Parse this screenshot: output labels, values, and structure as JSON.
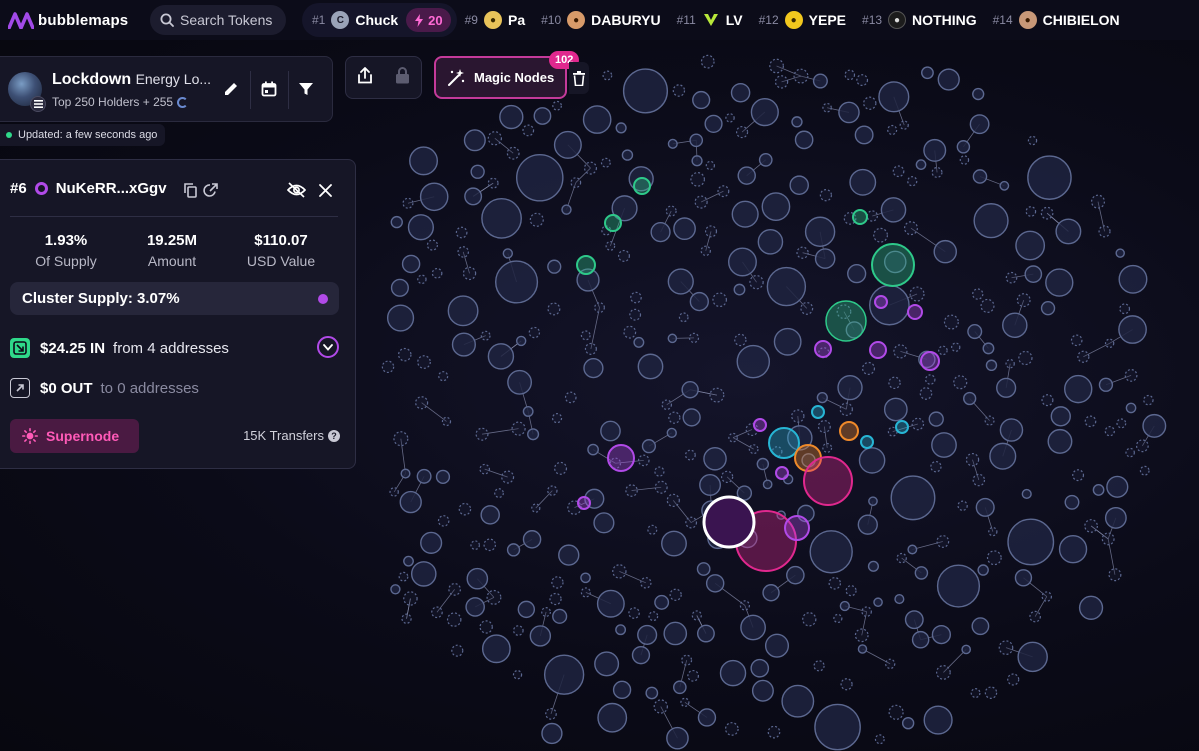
{
  "app": {
    "name": "bubblemaps"
  },
  "search": {
    "placeholder": "Search Tokens"
  },
  "trending": {
    "items": [
      {
        "rank": "#1",
        "name": "Chuck",
        "avatar_color": "#9aa3b8",
        "boost": "20"
      },
      {
        "rank": "#9",
        "name": "Pa",
        "avatar_color": "#e8c35a"
      },
      {
        "rank": "#10",
        "name": "DABURYU",
        "avatar_color": "#d89b6a"
      },
      {
        "rank": "#11",
        "name": "LV",
        "avatar_color": "#b8e83a"
      },
      {
        "rank": "#12",
        "name": "YEPE",
        "avatar_color": "#f2c81e"
      },
      {
        "rank": "#13",
        "name": "NOTHING",
        "avatar_color": "#1c1c1c"
      },
      {
        "rank": "#14",
        "name": "CHIBIELON",
        "avatar_color": "#c89878"
      }
    ]
  },
  "map_card": {
    "title": "Lockdown",
    "subtitle": "Energy Lo...",
    "holders_line": "Top 250 Holders + 255",
    "updated": "Updated: a few seconds ago",
    "icons": [
      "edit-icon",
      "calendar-icon",
      "filter-icon"
    ]
  },
  "toolbar": {
    "icons": [
      "share-icon",
      "lock-icon",
      "magic-wand-icon",
      "trash-icon"
    ],
    "magic_label": "Magic Nodes",
    "magic_count": "102"
  },
  "wallet": {
    "rank": "#6",
    "address": "NuKeRR...xGgv",
    "stats": [
      {
        "value": "1.93%",
        "label": "Of Supply"
      },
      {
        "value": "19.25M",
        "label": "Amount"
      },
      {
        "value": "$110.07",
        "label": "USD Value"
      }
    ],
    "cluster_supply": "Cluster Supply: 3.07%",
    "inflow": {
      "amount": "$24.25 IN",
      "desc": "from 4 addresses"
    },
    "outflow": {
      "amount": "$0 OUT",
      "desc": "to 0 addresses"
    },
    "supernode_label": "Supernode",
    "transfers": "15K Transfers",
    "icons": [
      "copy-icon",
      "external-link-icon",
      "eye-off-icon",
      "close-icon",
      "chevron-down-icon",
      "help-icon"
    ]
  },
  "colors": {
    "background": "#0b0b18",
    "bubble_fill": "#1e2340",
    "bubble_stroke": "#5c6890",
    "accent_pink": "#e0288e",
    "accent_purple": "#b14ae8",
    "cluster_green": "#2ec98a",
    "cluster_cyan": "#27b5d4",
    "cluster_orange": "#f08a2a",
    "selected_dark": "#3a1450",
    "positive": "#2fd88a"
  }
}
